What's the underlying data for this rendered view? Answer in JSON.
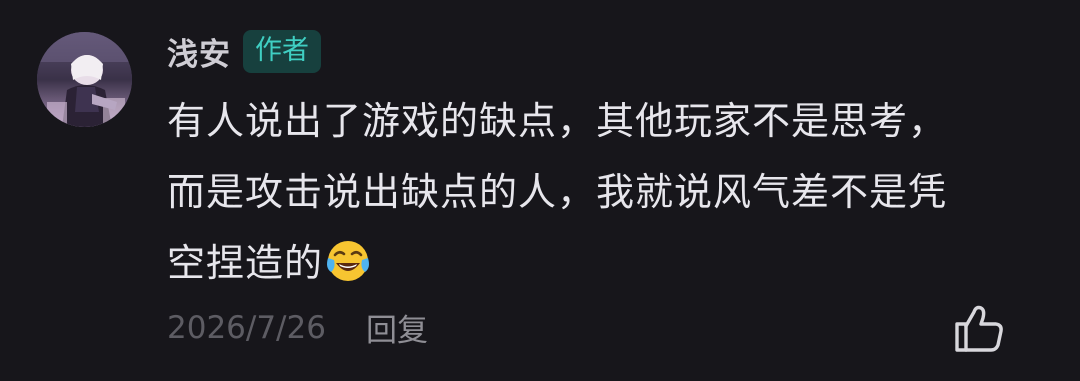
{
  "comment": {
    "username": "浅安",
    "badge": "作者",
    "content_lines": [
      "有人说出了游戏的缺点，其他玩家不是思考，",
      "而是攻击说出缺点的人，我就说风气差不是凭",
      "空捏造的"
    ],
    "emoji_icon": "face-with-tears-of-joy-icon",
    "date": "2026/7/26",
    "reply_label": "回复",
    "like_icon": "thumbs-up-icon"
  },
  "colors": {
    "background": "#17161b",
    "badge_bg": "#17403e",
    "badge_text": "#3fcfc3",
    "meta_text": "#5d5c63"
  }
}
